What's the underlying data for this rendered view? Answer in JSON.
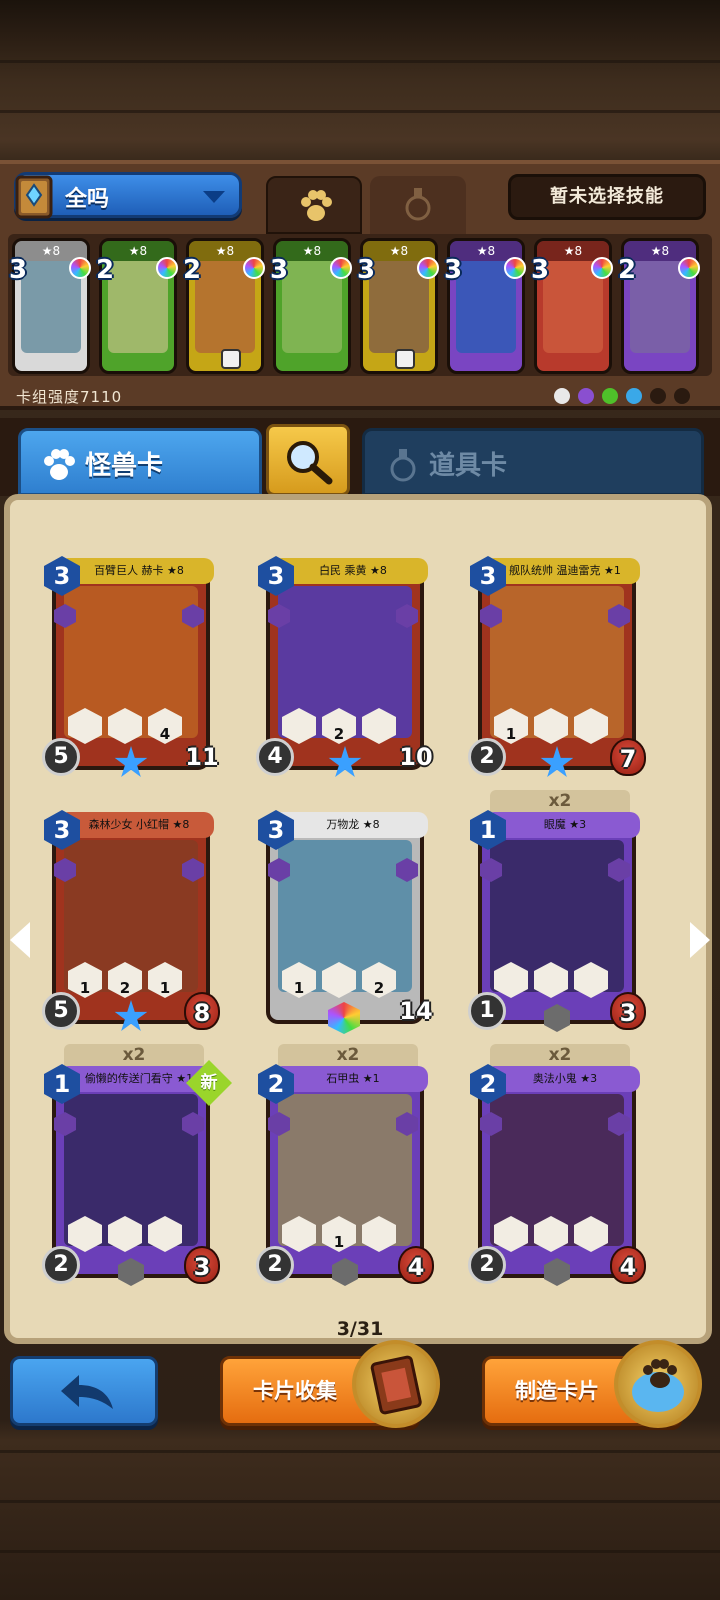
{
  "deck": {
    "name": "全吗",
    "skill_button": "暂未选择技能",
    "strength": "卡组强度7110"
  },
  "deck_cards": [
    {
      "cost": "3",
      "stars": "★8",
      "color": "#d9d9d9",
      "art": "#7a9aa8"
    },
    {
      "cost": "2",
      "stars": "★8",
      "color": "#4fa32a",
      "art": "#9fb86a"
    },
    {
      "cost": "2",
      "stars": "★8",
      "color": "#c5a616",
      "art": "#b5742e"
    },
    {
      "cost": "3",
      "stars": "★8",
      "color": "#4fa32a",
      "art": "#7fb452"
    },
    {
      "cost": "3",
      "stars": "★8",
      "color": "#c5a616",
      "art": "#8f6c3c"
    },
    {
      "cost": "3",
      "stars": "★8",
      "color": "#7a45c2",
      "art": "#3b57b8"
    },
    {
      "cost": "3",
      "stars": "★8",
      "color": "#b83a2c",
      "art": "#c9553a"
    },
    {
      "cost": "2",
      "stars": "★8",
      "color": "#7a45c2",
      "art": "#7a5fa8"
    }
  ],
  "tabs": {
    "monster": "怪兽卡",
    "item": "道具卡"
  },
  "cards": [
    {
      "name": "百臂巨人 赫卡 ★8",
      "cost": "3",
      "attack": "5",
      "hp": "11",
      "frame": "#a0331e",
      "banner": "#d9b52a",
      "art": "#b85a22",
      "abilities": [
        "",
        "",
        "4"
      ],
      "bottom": "star"
    },
    {
      "name": "白民 乘黄 ★8",
      "cost": "3",
      "attack": "4",
      "hp": "10",
      "frame": "#a0331e",
      "banner": "#d9b52a",
      "art": "#5a3aa0",
      "abilities": [
        "",
        "2",
        ""
      ],
      "bottom": "star"
    },
    {
      "name": "舰队统帅 温迪雷克 ★1",
      "cost": "3",
      "attack": "2",
      "hp": "7",
      "frame": "#a0331e",
      "banner": "#d9b52a",
      "art": "#b8652a",
      "abilities": [
        "1",
        "",
        ""
      ],
      "bottom": "star"
    },
    {
      "name": "森林少女 小红帽 ★8",
      "cost": "3",
      "attack": "5",
      "hp": "8",
      "frame": "#a0331e",
      "banner": "#c85a3a",
      "art": "#8a3a22",
      "abilities": [
        "1",
        "2",
        "1"
      ],
      "bottom": "star"
    },
    {
      "name": "万物龙 ★8",
      "cost": "3",
      "attack": "",
      "hp": "14",
      "frame": "#b9b9b9",
      "banner": "#e6e6e6",
      "art": "#5f8fa8",
      "abilities": [
        "1",
        "",
        "2"
      ],
      "bottom": "rainbow"
    },
    {
      "name": "眼魔 ★3",
      "cost": "1",
      "attack": "1",
      "hp": "3",
      "frame": "#6b3fb8",
      "banner": "#8a5ad2",
      "art": "#3a2a6a",
      "abilities": [
        "",
        "",
        ""
      ],
      "bottom": "hex",
      "dup": "x2"
    },
    {
      "name": "偷懒的传送门看守 ★1",
      "cost": "1",
      "attack": "2",
      "hp": "3",
      "frame": "#6b3fb8",
      "banner": "#8a5ad2",
      "art": "#3a2a6a",
      "abilities": [
        "",
        "",
        ""
      ],
      "bottom": "hex",
      "dup": "x2"
    },
    {
      "name": "石甲虫 ★1",
      "cost": "2",
      "attack": "2",
      "hp": "4",
      "frame": "#6b3fb8",
      "banner": "#8a5ad2",
      "art": "#8a7a6a",
      "abilities": [
        "",
        "1",
        ""
      ],
      "bottom": "hex",
      "dup": "x2"
    },
    {
      "name": "奥法小鬼 ★3",
      "cost": "2",
      "attack": "2",
      "hp": "4",
      "frame": "#6b3fb8",
      "banner": "#8a5ad2",
      "art": "#4a2a5a",
      "abilities": [
        "",
        "",
        ""
      ],
      "bottom": "hex",
      "dup": "x2"
    }
  ],
  "new_badge": "新",
  "page": "3/31",
  "buttons": {
    "collect": "卡片收集",
    "craft": "制造卡片"
  },
  "element_colors": [
    "#e8e8e8",
    "#8a4fd0",
    "#4fc02a",
    "#3aa8e8",
    "#2a1a10",
    "#2a1a10"
  ]
}
